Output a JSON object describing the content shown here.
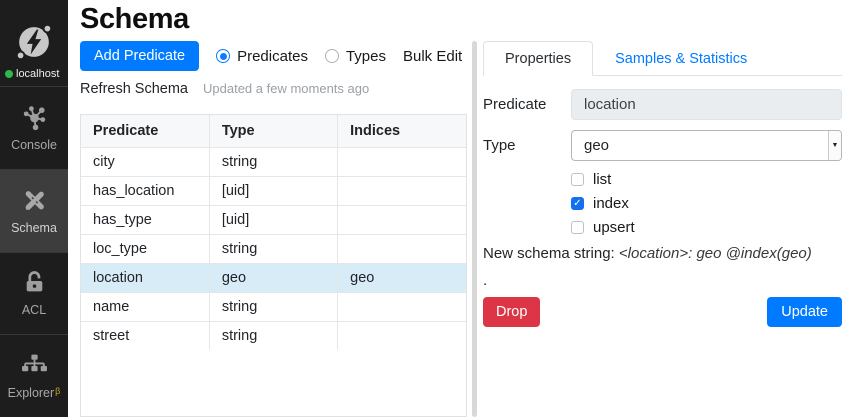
{
  "sidebar": {
    "server": {
      "label": "localhost",
      "status": "connected",
      "status_color": "#2db84b"
    },
    "items": [
      {
        "label": "Console",
        "icon": "graph-nodes-icon",
        "active": false
      },
      {
        "label": "Schema",
        "icon": "pencil-ruler-icon",
        "active": true
      },
      {
        "label": "ACL",
        "icon": "unlock-icon",
        "active": false
      },
      {
        "label": "Explorer",
        "icon": "sitemap-icon",
        "active": false,
        "badge": "β"
      }
    ]
  },
  "header": {
    "title": "Schema"
  },
  "toolbar": {
    "add_predicate_label": "Add Predicate",
    "radio_predicates": "Predicates",
    "radio_types": "Types",
    "bulk_edit_label": "Bulk Edit",
    "refresh_label": "Refresh Schema",
    "updated_text": "Updated a few moments ago"
  },
  "table": {
    "columns": [
      "Predicate",
      "Type",
      "Indices"
    ],
    "rows": [
      {
        "predicate": "city",
        "type": "string",
        "indices": "",
        "selected": false
      },
      {
        "predicate": "has_location",
        "type": "[uid]",
        "indices": "",
        "selected": false
      },
      {
        "predicate": "has_type",
        "type": "[uid]",
        "indices": "",
        "selected": false
      },
      {
        "predicate": "loc_type",
        "type": "string",
        "indices": "",
        "selected": false
      },
      {
        "predicate": "location",
        "type": "geo",
        "indices": "geo",
        "selected": true
      },
      {
        "predicate": "name",
        "type": "string",
        "indices": "",
        "selected": false
      },
      {
        "predicate": "street",
        "type": "string",
        "indices": "",
        "selected": false
      }
    ]
  },
  "panel": {
    "tabs": [
      {
        "label": "Properties",
        "active": true
      },
      {
        "label": "Samples & Statistics",
        "active": false
      }
    ],
    "form": {
      "predicate_label": "Predicate",
      "predicate_value": "location",
      "type_label": "Type",
      "type_value": "geo",
      "checkboxes": [
        {
          "label": "list",
          "checked": false,
          "glyph": ""
        },
        {
          "label": "index",
          "checked": true,
          "glyph": "✓"
        },
        {
          "label": "upsert",
          "checked": false,
          "glyph": ""
        }
      ],
      "schema_string_prefix": "New schema string: ",
      "schema_string": "<location>: geo @index(geo)",
      "schema_string_suffix": ".",
      "drop_label": "Drop",
      "update_label": "Update"
    }
  },
  "colors": {
    "accent_blue": "#007bff",
    "danger_red": "#dc3545",
    "selected_row": "#d8ecf8",
    "sidebar_bg": "#1d1d1d",
    "sidebar_active_bg": "#3d3d3d",
    "status_green": "#2db84b",
    "beta_gold": "#c9a227"
  }
}
